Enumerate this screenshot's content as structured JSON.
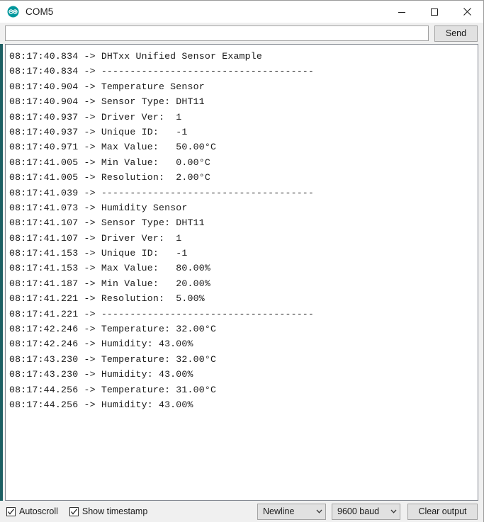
{
  "window": {
    "title": "COM5",
    "logo_icon": "arduino-infinity-logo",
    "accent_color": "#00979c",
    "controls": {
      "minimize_icon": "minimize-icon",
      "maximize_icon": "maximize-icon",
      "close_icon": "close-icon"
    }
  },
  "send_row": {
    "input_value": "",
    "input_placeholder": "",
    "send_label": "Send"
  },
  "console": {
    "lines": [
      "08:17:40.834 -> DHTxx Unified Sensor Example",
      "08:17:40.834 -> -------------------------------------",
      "08:17:40.904 -> Temperature Sensor",
      "08:17:40.904 -> Sensor Type: DHT11",
      "08:17:40.937 -> Driver Ver:  1",
      "08:17:40.937 -> Unique ID:   -1",
      "08:17:40.971 -> Max Value:   50.00°C",
      "08:17:41.005 -> Min Value:   0.00°C",
      "08:17:41.005 -> Resolution:  2.00°C",
      "08:17:41.039 -> -------------------------------------",
      "08:17:41.073 -> Humidity Sensor",
      "08:17:41.107 -> Sensor Type: DHT11",
      "08:17:41.107 -> Driver Ver:  1",
      "08:17:41.153 -> Unique ID:   -1",
      "08:17:41.153 -> Max Value:   80.00%",
      "08:17:41.187 -> Min Value:   20.00%",
      "08:17:41.221 -> Resolution:  5.00%",
      "08:17:41.221 -> -------------------------------------",
      "08:17:42.246 -> Temperature: 32.00°C",
      "08:17:42.246 -> Humidity: 43.00%",
      "08:17:43.230 -> Temperature: 32.00°C",
      "08:17:43.230 -> Humidity: 43.00%",
      "08:17:44.256 -> Temperature: 31.00°C",
      "08:17:44.256 -> Humidity: 43.00%"
    ]
  },
  "statusbar": {
    "autoscroll_label": "Autoscroll",
    "autoscroll_checked": true,
    "show_timestamp_label": "Show timestamp",
    "show_timestamp_checked": true,
    "line_ending_value": "Newline",
    "baud_rate_value": "9600 baud",
    "clear_output_label": "Clear output",
    "checkmark_icon": "checkmark-icon",
    "chevron_down_icon": "chevron-down-icon"
  }
}
